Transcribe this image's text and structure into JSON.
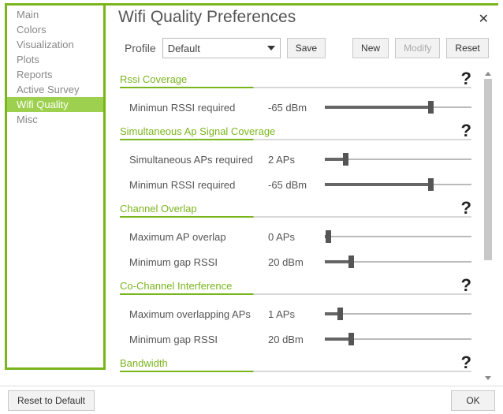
{
  "title": "Wifi Quality Preferences",
  "sidebar": {
    "items": [
      {
        "label": "Main"
      },
      {
        "label": "Colors"
      },
      {
        "label": "Visualization"
      },
      {
        "label": "Plots"
      },
      {
        "label": "Reports"
      },
      {
        "label": "Active Survey"
      },
      {
        "label": "Wifi Quality"
      },
      {
        "label": "Misc"
      }
    ],
    "selected": 6
  },
  "profile": {
    "label": "Profile",
    "selected": "Default",
    "save": "Save",
    "new": "New",
    "modify": "Modify",
    "reset": "Reset"
  },
  "sections": [
    {
      "title": "Rssi Coverage",
      "rows": [
        {
          "label": "Minimun RSSI required",
          "value": "-65 dBm",
          "pct": 72
        }
      ]
    },
    {
      "title": "Simultaneous Ap Signal Coverage",
      "rows": [
        {
          "label": "Simultaneous APs required",
          "value": "2 APs",
          "pct": 14
        },
        {
          "label": "Minimun RSSI required",
          "value": "-65 dBm",
          "pct": 72
        }
      ]
    },
    {
      "title": "Channel Overlap",
      "rows": [
        {
          "label": "Maximum AP overlap",
          "value": "0 APs",
          "pct": 2
        },
        {
          "label": "Minimum gap RSSI",
          "value": "20 dBm",
          "pct": 18
        }
      ]
    },
    {
      "title": "Co-Channel Interference",
      "rows": [
        {
          "label": "Maximum overlapping APs",
          "value": "1 APs",
          "pct": 10
        },
        {
          "label": "Minimum gap RSSI",
          "value": "20 dBm",
          "pct": 18
        }
      ]
    },
    {
      "title": "Bandwidth",
      "rows": []
    }
  ],
  "footer": {
    "reset": "Reset to Default",
    "ok": "OK"
  }
}
